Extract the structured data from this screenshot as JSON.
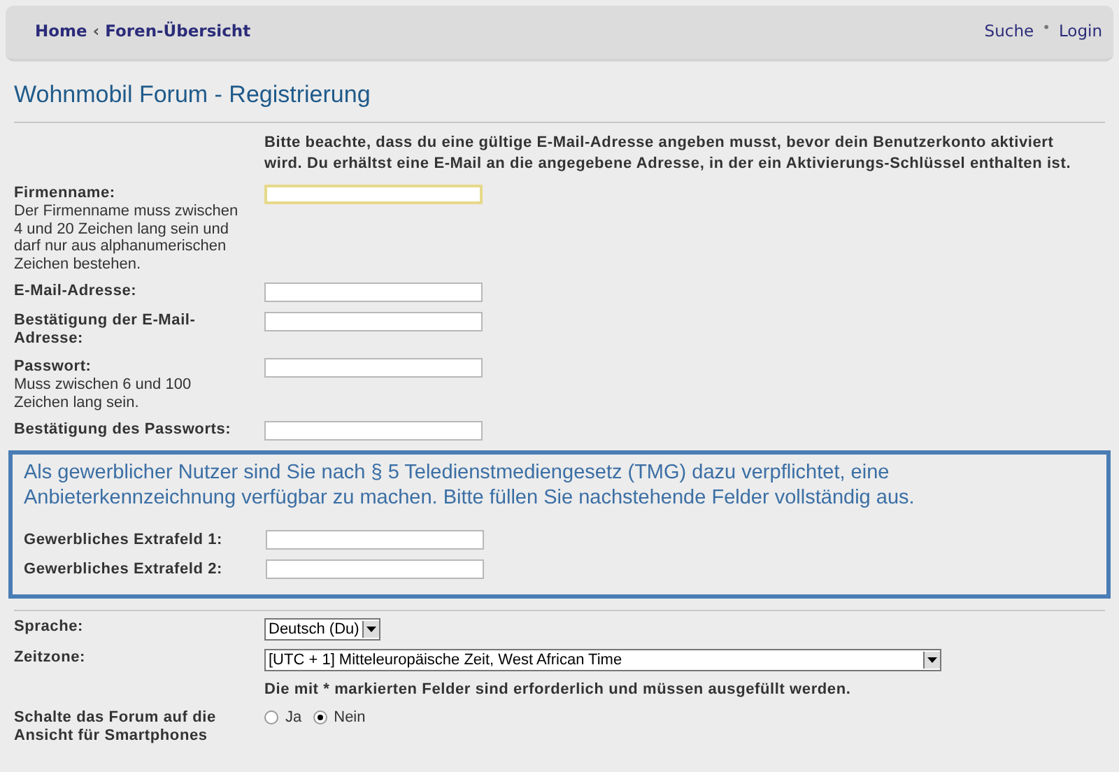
{
  "nav": {
    "breadcrumbs": [
      "Home",
      "Foren-Übersicht"
    ],
    "separator": "‹",
    "links": [
      "Suche",
      "Login"
    ],
    "link_separator": "•"
  },
  "title": "Wohnmobil Forum - Registrierung",
  "notice": "Bitte beachte, dass du eine gültige E-Mail-Adresse angeben musst, bevor dein Benutzerkonto aktiviert wird. Du erhältst eine E-Mail an die angegebene Adresse, in der ein Aktivierungs-Schlüssel enthalten ist.",
  "fields": [
    {
      "label": "Firmenname:",
      "hint": "Der Firmenname muss zwischen 4 und 20 Zeichen lang sein und darf nur aus alphanumerischen Zeichen bestehen.",
      "focused": true
    },
    {
      "label": "E-Mail-Adresse:",
      "focused": false
    },
    {
      "label": "Bestätigung der E-Mail-Adresse:",
      "focused": false
    },
    {
      "label": "Passwort:",
      "hint": "Muss zwischen 6 und 100 Zeichen lang sein.",
      "focused": false
    },
    {
      "label": "Bestätigung des Passworts:",
      "focused": false
    }
  ],
  "commercial": {
    "notice": "Als gewerblicher Nutzer sind Sie nach § 5 Teledienstmediengesetz (TMG) dazu verpflichtet, eine Anbieterkennzeichnung verfügbar zu machen. Bitte füllen Sie nachstehende Felder vollständig aus.",
    "fields": [
      {
        "label": "Gewerbliches Extrafeld 1:"
      },
      {
        "label": "Gewerbliches Extrafeld 2:"
      }
    ]
  },
  "settings": [
    {
      "kind": "select",
      "label": "Sprache:",
      "value": "Deutsch (Du)",
      "wide": false
    },
    {
      "kind": "select",
      "label": "Zeitzone:",
      "value": "[UTC + 1] Mitteleuropäische Zeit, West African Time",
      "wide": true
    },
    {
      "kind": "note",
      "text": "Die mit * markierten Felder sind erforderlich und müssen ausgefüllt werden."
    },
    {
      "kind": "radio",
      "label": "Schalte das Forum auf die Ansicht für Smartphones",
      "options": [
        {
          "label": "Ja",
          "selected": false
        },
        {
          "label": "Nein",
          "selected": true
        }
      ]
    }
  ]
}
